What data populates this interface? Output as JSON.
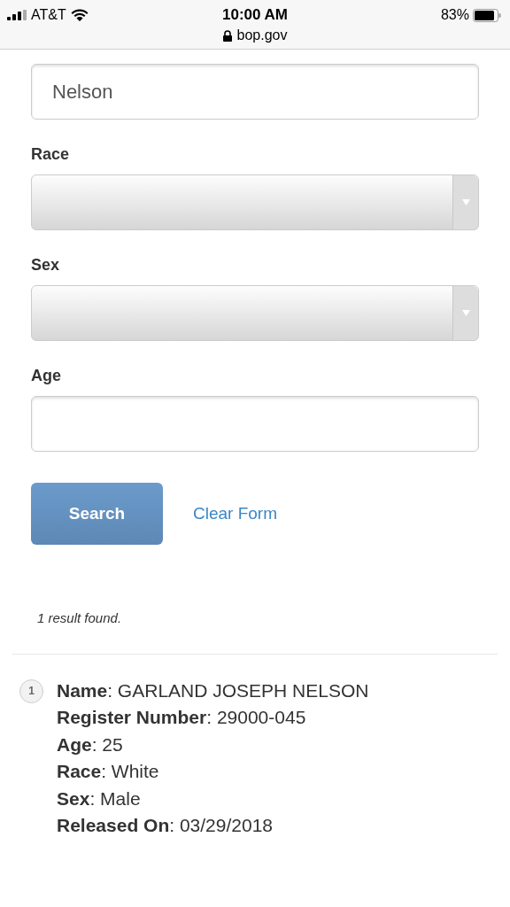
{
  "status_bar": {
    "carrier": "AT&T",
    "time": "10:00 AM",
    "url": "bop.gov",
    "battery": "83%"
  },
  "form": {
    "fields": [
      {
        "kind": "text",
        "value": "Nelson"
      },
      {
        "kind": "select",
        "label": "Race"
      },
      {
        "kind": "select",
        "label": "Sex"
      },
      {
        "kind": "text",
        "label": "Age"
      }
    ],
    "search_button": "Search",
    "clear_link": "Clear Form"
  },
  "results": {
    "summary": "1 result found.",
    "items": [
      {
        "number": "1",
        "lines": [
          "**Name**: GARLAND JOSEPH NELSON",
          "**Register Number**: 29000-045",
          "**Age**: 25",
          "**Race**: White",
          "**Sex**: Male",
          "**Released On**: 03/29/2018"
        ]
      }
    ]
  }
}
